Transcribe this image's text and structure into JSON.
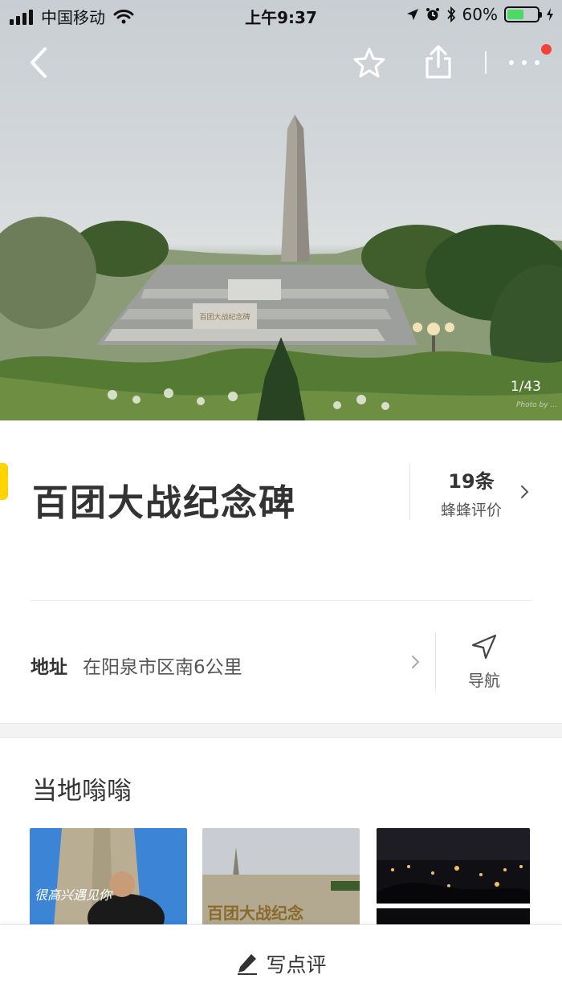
{
  "status_bar": {
    "carrier": "中国移动",
    "time": "上午9:37",
    "battery_percent": "60%",
    "battery_level": 0.6,
    "icons": [
      "signal-icon",
      "wifi-icon",
      "location-arrow-icon",
      "alarm-icon",
      "bluetooth-icon",
      "battery-icon",
      "charging-icon"
    ]
  },
  "nav": {
    "icons": [
      "back-icon",
      "star-icon",
      "share-icon",
      "more-icon"
    ],
    "has_notification_dot": true
  },
  "gallery": {
    "counter": "1/43",
    "watermark": "Photo by ..."
  },
  "poi": {
    "title": "百团大战纪念碑",
    "review_count": "19条",
    "review_label": "蜂蜂评价"
  },
  "address": {
    "label": "地址",
    "value": "在阳泉市区南6公里",
    "nav_label": "导航"
  },
  "local": {
    "title": "当地嗡嗡",
    "thumbnails": [
      {
        "caption": "很高兴遇见你"
      },
      {
        "caption": "百团大战纪念"
      },
      {
        "caption": ""
      }
    ]
  },
  "bottom": {
    "write_review": "写点评"
  },
  "colors": {
    "accent_yellow": "#ffd400",
    "notification_red": "#f44336",
    "battery_green": "#4cd964",
    "text_primary": "#333333",
    "text_secondary": "#555555"
  }
}
